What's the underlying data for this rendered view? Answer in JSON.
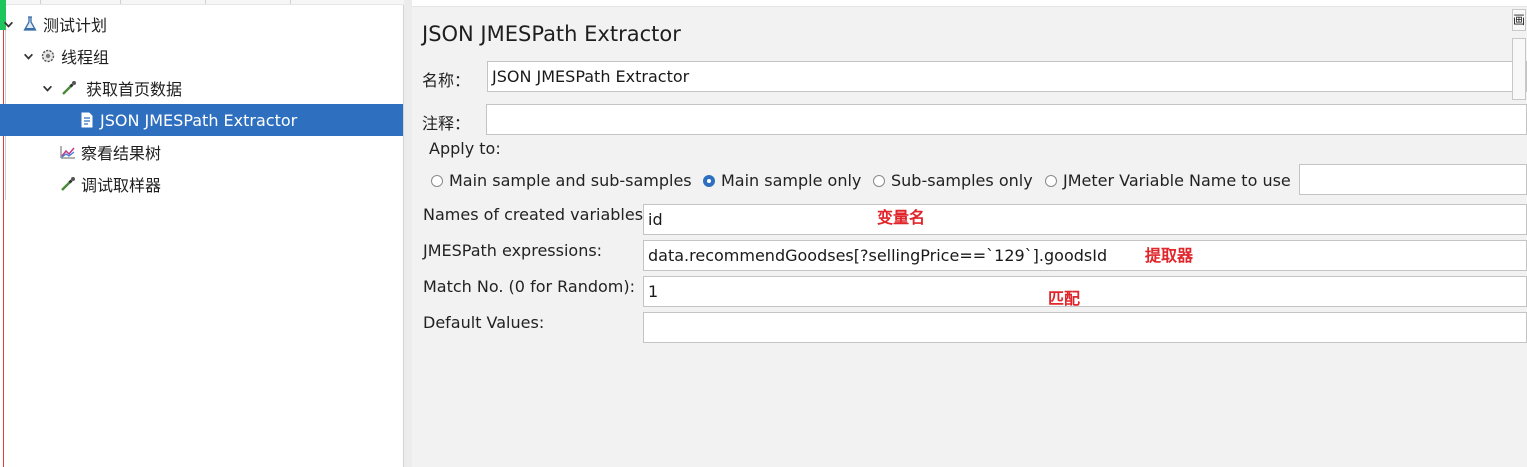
{
  "tree": {
    "items": [
      {
        "label": "测试计划",
        "icon": "flask-icon",
        "expanded": true
      },
      {
        "label": "线程组",
        "icon": "gear-icon",
        "expanded": true
      },
      {
        "label": "获取首页数据",
        "icon": "pipette-icon",
        "expanded": true
      },
      {
        "label": "JSON JMESPath Extractor",
        "icon": "document-icon",
        "selected": true
      },
      {
        "label": "察看结果树",
        "icon": "chart-icon"
      },
      {
        "label": "调试取样器",
        "icon": "pipette-icon"
      }
    ]
  },
  "panel": {
    "title": "JSON JMESPath Extractor",
    "name_label": "名称：",
    "name_value": "JSON JMESPath Extractor",
    "comment_label": "注释：",
    "comment_value": "",
    "apply_to": {
      "label": "Apply to:",
      "options": [
        {
          "label": "Main sample and sub-samples",
          "selected": false
        },
        {
          "label": "Main sample only",
          "selected": true
        },
        {
          "label": "Sub-samples only",
          "selected": false
        },
        {
          "label": "JMeter Variable Name to use",
          "selected": false
        }
      ],
      "variable_value": ""
    },
    "fields": {
      "names_label": "Names of created variables:",
      "names_value": "id",
      "expr_label": "JMESPath expressions:",
      "expr_value": "data.recommendGoodses[?sellingPrice==`129`].goodsId",
      "match_label": "Match No. (0 for Random):",
      "match_value": "1",
      "default_label": "Default Values:",
      "default_value": ""
    },
    "annotations": {
      "variable_name": "变量名",
      "extractor": "提取器",
      "match": "匹配"
    },
    "side_glyph": "画"
  },
  "colors": {
    "selection": "#2f6fbf",
    "annotation": "#e0252b",
    "panel_bg": "#f2f2f2"
  }
}
